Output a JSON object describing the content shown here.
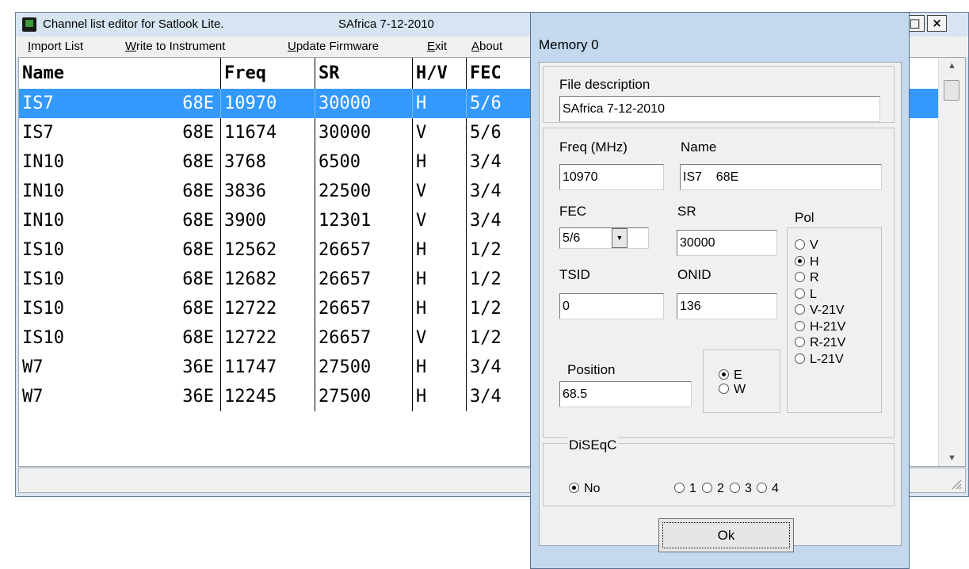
{
  "window": {
    "title": "Channel list editor for Satlook Lite.",
    "file_label": "SAfrica 7-12-2010",
    "minimize_glyph": "_",
    "maximize_glyph": "□",
    "close_glyph": "×"
  },
  "menu": [
    {
      "prefix": "",
      "underlined": "I",
      "rest": "mport List"
    },
    {
      "prefix": "",
      "underlined": "W",
      "rest": "rite to Instrument"
    },
    {
      "prefix": "",
      "underlined": "U",
      "rest": "pdate Firmware"
    },
    {
      "prefix": "",
      "underlined": "E",
      "rest": "xit"
    },
    {
      "prefix": "",
      "underlined": "A",
      "rest": "bout"
    }
  ],
  "table": {
    "columns": [
      "Name",
      "Freq",
      "SR",
      "H/V",
      "FEC"
    ],
    "rows": [
      {
        "name": "IS7",
        "pos": "68E",
        "freq": "10970",
        "sr": "30000",
        "pol": "H",
        "fec": "5/6",
        "selected": true
      },
      {
        "name": "IS7",
        "pos": "68E",
        "freq": "11674",
        "sr": "30000",
        "pol": "V",
        "fec": "5/6"
      },
      {
        "name": "IN10",
        "pos": "68E",
        "freq": "3768",
        "sr": "6500",
        "pol": "H",
        "fec": "3/4"
      },
      {
        "name": "IN10",
        "pos": "68E",
        "freq": "3836",
        "sr": "22500",
        "pol": "V",
        "fec": "3/4"
      },
      {
        "name": "IN10",
        "pos": "68E",
        "freq": "3900",
        "sr": "12301",
        "pol": "V",
        "fec": "3/4"
      },
      {
        "name": "IS10",
        "pos": "68E",
        "freq": "12562",
        "sr": "26657",
        "pol": "H",
        "fec": "1/2"
      },
      {
        "name": "IS10",
        "pos": "68E",
        "freq": "12682",
        "sr": "26657",
        "pol": "H",
        "fec": "1/2"
      },
      {
        "name": "IS10",
        "pos": "68E",
        "freq": "12722",
        "sr": "26657",
        "pol": "H",
        "fec": "1/2"
      },
      {
        "name": "IS10",
        "pos": "68E",
        "freq": "12722",
        "sr": "26657",
        "pol": "V",
        "fec": "1/2"
      },
      {
        "name": "W7",
        "pos": "36E",
        "freq": "11747",
        "sr": "27500",
        "pol": "H",
        "fec": "3/4"
      },
      {
        "name": "W7",
        "pos": "36E",
        "freq": "12245",
        "sr": "27500",
        "pol": "H",
        "fec": "3/4"
      }
    ],
    "selected_color": "#3399ff"
  },
  "dialog": {
    "title": "Memory 0",
    "file_description_label": "File description",
    "file_description_value": "SAfrica 7-12-2010",
    "freq_label": "Freq (MHz)",
    "freq_value": "10970",
    "name_label": "Name",
    "name_value": "IS7    68E",
    "fec_label": "FEC",
    "fec_value": "5/6",
    "sr_label": "SR",
    "sr_value": "30000",
    "pol_label": "Pol",
    "pol_options": [
      "V",
      "H",
      "R",
      "L",
      "V-21V",
      "H-21V",
      "R-21V",
      "L-21V"
    ],
    "pol_selected": "H",
    "tsid_label": "TSID",
    "tsid_value": "0",
    "onid_label": "ONID",
    "onid_value": "136",
    "position_label": "Position",
    "position_value": "68.5",
    "dir_options": [
      "E",
      "W"
    ],
    "dir_selected": "E",
    "diseqc_label": "DiSEqC",
    "diseqc_options": [
      "No",
      "1",
      "2",
      "3",
      "4"
    ],
    "diseqc_selected": "No",
    "ok_label": "Ok"
  }
}
